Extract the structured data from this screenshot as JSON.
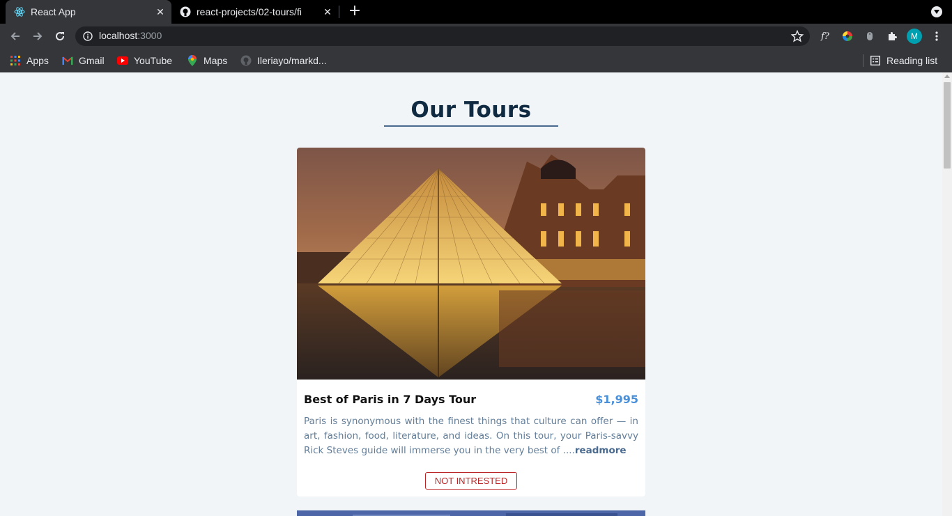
{
  "browser": {
    "tabs": [
      {
        "title": "React App",
        "icon": "react-icon"
      },
      {
        "title": "react-projects/02-tours/fi",
        "icon": "github-icon"
      }
    ],
    "url": {
      "host": "localhost",
      "port": ":3000"
    },
    "bookmarks": [
      {
        "label": "Apps",
        "icon": "apps-grid-icon"
      },
      {
        "label": "Gmail",
        "icon": "gmail-icon"
      },
      {
        "label": "YouTube",
        "icon": "youtube-icon"
      },
      {
        "label": "Maps",
        "icon": "maps-icon"
      },
      {
        "label": "Ileriayo/markd...",
        "icon": "github-icon"
      }
    ],
    "reading_list": "Reading list",
    "avatar_initial": "M",
    "extension_label": "f?"
  },
  "page": {
    "title": "Our Tours",
    "tours": [
      {
        "name": "Best of Paris in 7 Days Tour",
        "price": "$1,995",
        "info": "Paris is synonymous with the finest things that culture can offer — in art, fashion, food, literature, and ideas. On this tour, your Paris-savvy Rick Steves guide will immerse you in the very best of ....",
        "readmore": "readmore",
        "button": "NOT INTRESTED"
      }
    ]
  },
  "colors": {
    "accent": "#49698e",
    "price": "#4a90d9",
    "danger": "#bb2525",
    "background": "#f1f5f8"
  }
}
